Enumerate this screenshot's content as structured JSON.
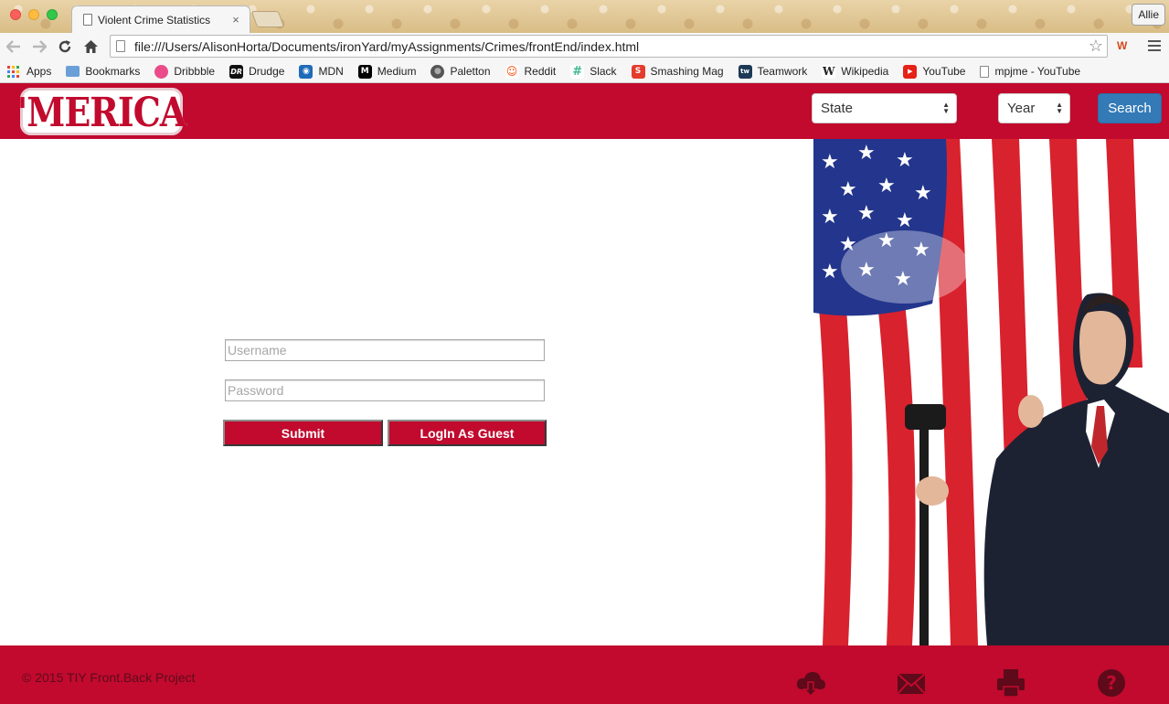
{
  "browser": {
    "tab_title": "Violent Crime Statistics",
    "tab_close": "×",
    "profile_name": "Allie",
    "url": "file:///Users/AlisonHorta/Documents/ironYard/myAssignments/Crimes/frontEnd/index.html",
    "bookmarks": [
      {
        "label": "Apps",
        "icon": "apps-grid-icon"
      },
      {
        "label": "Bookmarks",
        "icon": "folder-icon",
        "color": "#6b9fd8"
      },
      {
        "label": "Dribbble",
        "icon": "dribbble-icon",
        "color": "#ea4c89"
      },
      {
        "label": "Drudge",
        "icon": "drudge-icon",
        "color": "#111111",
        "glyph": "DR"
      },
      {
        "label": "MDN",
        "icon": "mdn-icon",
        "color": "#1e6bb8",
        "glyph": "◉"
      },
      {
        "label": "Medium",
        "icon": "medium-icon",
        "color": "#000000",
        "glyph": "M"
      },
      {
        "label": "Paletton",
        "icon": "paletton-icon",
        "color": "#555555",
        "glyph": "●"
      },
      {
        "label": "Reddit",
        "icon": "reddit-icon",
        "color": "#ff4500",
        "glyph": "☺"
      },
      {
        "label": "Slack",
        "icon": "slack-icon",
        "color": "#3eb991",
        "glyph": "#"
      },
      {
        "label": "Smashing Mag",
        "icon": "smashing-icon",
        "color": "#e53b2c",
        "glyph": "S"
      },
      {
        "label": "Teamwork",
        "icon": "teamwork-icon",
        "color": "#1c3a57",
        "glyph": "tw"
      },
      {
        "label": "Wikipedia",
        "icon": "wikipedia-icon",
        "color": "#ffffff",
        "glyph": "W"
      },
      {
        "label": "YouTube",
        "icon": "youtube-icon",
        "color": "#e62117",
        "glyph": "▶"
      },
      {
        "label": "mpjme - YouTube",
        "icon": "page-icon",
        "color": "#ffffff",
        "glyph": ""
      }
    ]
  },
  "header": {
    "logo_text": "'MERICA",
    "state_select": "State",
    "year_select": "Year",
    "search_label": "Search",
    "colors": {
      "brand_red": "#c10a2e",
      "search_blue": "#337ab7"
    }
  },
  "login": {
    "username_placeholder": "Username",
    "password_placeholder": "Password",
    "submit_label": "Submit",
    "guest_label": "LogIn As Guest"
  },
  "hero": {
    "image": "american-flag-with-man-in-suit"
  },
  "footer": {
    "copyright": "© 2015 TIY Front.Back Project",
    "icons": [
      "cloud-download-icon",
      "envelope-icon",
      "print-icon",
      "help-icon"
    ]
  }
}
